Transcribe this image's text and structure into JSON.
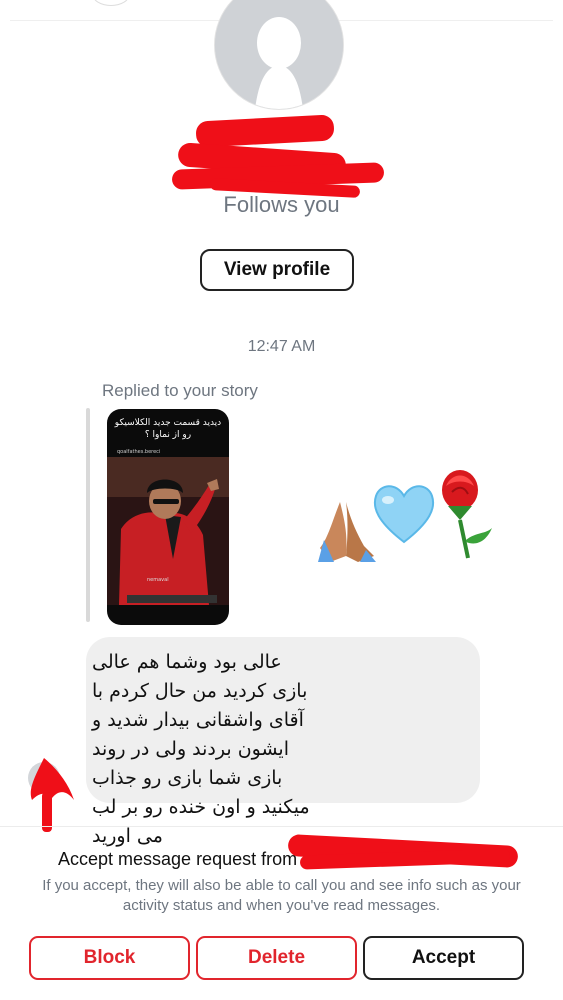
{
  "profile": {
    "follows_text": "Follows you",
    "view_profile_label": "View profile"
  },
  "thread": {
    "timestamp": "12:47 AM",
    "replied_label": "Replied to your story",
    "story": {
      "headline": "دیدید قسمت جدید الکلاسیکو رو از نماوا ؟",
      "username": "qoalfathes.bereci",
      "tag": "nemaval"
    },
    "emoji_message": [
      "folded-hands",
      "light-blue-heart",
      "rose"
    ],
    "message_text": "عالی بود وشما هم عالی بازی کردید من حال کردم با آقای واشقانی بیدار شدید و ایشون بردند ولی در روند بازی شما بازی رو جذاب میکنید و اون خنده رو بر لب می اورید"
  },
  "request": {
    "title": "Accept message request from",
    "info": "If you accept, they will also be able to call you and see info such as your activity status and when you've read messages.",
    "block_label": "Block",
    "delete_label": "Delete",
    "accept_label": "Accept"
  },
  "colors": {
    "destructive": "#e1252d",
    "redaction": "#ef0f18",
    "muted_text": "#6e7680",
    "bubble_bg": "#efefef"
  }
}
